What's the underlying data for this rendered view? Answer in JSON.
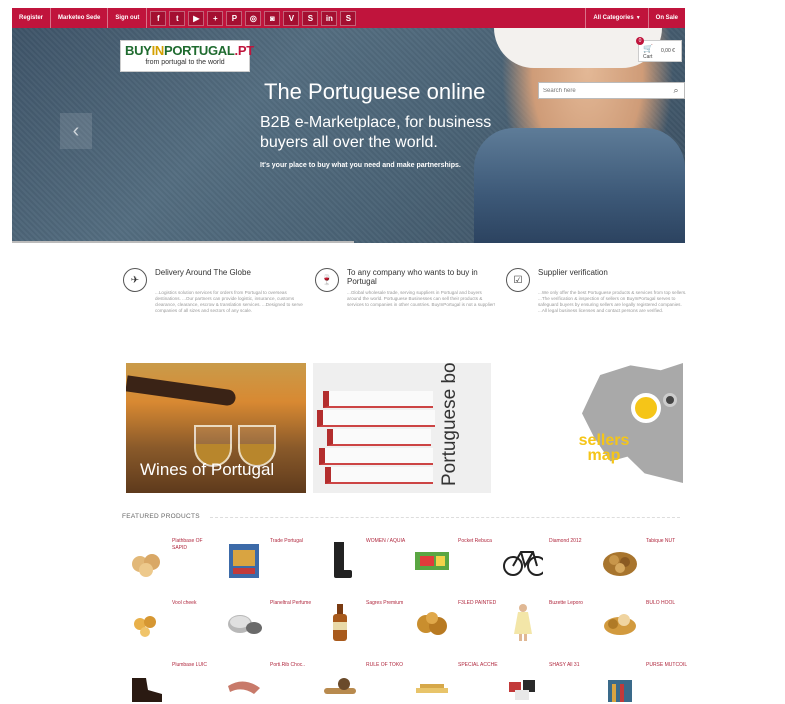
{
  "topbar": {
    "links": [
      "Register",
      "Marketeo Sede",
      "Sign out"
    ],
    "social_icons": [
      "facebook-icon",
      "twitter-icon",
      "youtube-icon",
      "share-icon",
      "pinterest-icon",
      "flickr-icon",
      "instagram-icon",
      "vimeo-icon",
      "tumblr-icon",
      "linkedin-icon",
      "skype-icon"
    ],
    "social_glyphs": [
      "f",
      "t",
      "▶",
      "+",
      "P",
      "◎",
      "◙",
      "V",
      "S",
      "in",
      "S"
    ],
    "categories_label": "All Categories",
    "sale_label": "On Sale",
    "accent_color": "#c0143c"
  },
  "hero": {
    "logo_main_a": "BUY",
    "logo_main_b": "IN",
    "logo_main_c": "PORTUGAL",
    "logo_main_d": ".PT",
    "logo_tagline": "from portugal to the world",
    "cart_count": "0",
    "cart_amount": "0,00 €",
    "cart_label": "Cart",
    "search_placeholder": "Search here",
    "headline": "The Portuguese online",
    "subheadline": "B2B e-Marketplace, for business buyers all over the world.",
    "tagline": "It's your place to buy what you need and make partnerships.",
    "prev_label": "‹",
    "next_label": "›"
  },
  "features": [
    {
      "icon": "airplane-icon",
      "glyph": "✈",
      "title": "Delivery Around The Globe",
      "text": "...Logistics solution services for orders from Portugal to overseas destinations. ...Our partners can provide logistic, insurance, customs clearance, clearance, escrow & translation services. ...Designed to serve companies of all sizes and sectors of any scale."
    },
    {
      "icon": "wine-glass-icon",
      "glyph": "🍷",
      "title": "To any company who wants to buy in Portugal",
      "text": "...Global wholesale trade, serving suppliers in Portugal and buyers around the world. Portuguese Businesses can sell their products & services to companies in other countries. BuyInPortugal is not a supplier!"
    },
    {
      "icon": "checkbox-icon",
      "glyph": "☑",
      "title": "Supplier verification",
      "text": "...We only offer the best Portuguese products & services from top sellers. ...The verification & inspection of sellers on BuyInPortugal serves to safeguard buyers by ensuring sellers are legally registered companies. ...All legal business licenses and contact persons are verified."
    }
  ],
  "banners": {
    "wine": "Wines of Portugal",
    "books": "Portuguese books",
    "map": "sellers map"
  },
  "featured": {
    "title": "FEATURED PRODUCTS",
    "products": [
      {
        "name": "Plathbase OF SAPID",
        "icon": "cookies-icon"
      },
      {
        "name": "Trade Portugal",
        "icon": "book-icon"
      },
      {
        "name": "WOMEN / AQUIA",
        "icon": "boots-icon"
      },
      {
        "name": "Pocket Rebuca",
        "icon": "candy-box-icon"
      },
      {
        "name": "Diamond 2012",
        "icon": "bicycle-icon"
      },
      {
        "name": "Tabique NUT",
        "icon": "nuts-icon"
      },
      {
        "name": "Vool cheek",
        "icon": "sweets-icon"
      },
      {
        "name": "Planeltral Perfume",
        "icon": "tin-icon"
      },
      {
        "name": "Sagres Premium",
        "icon": "beer-bottle-icon"
      },
      {
        "name": "F3LED PAINTED",
        "icon": "tart-icon"
      },
      {
        "name": "Buzette Leporo",
        "icon": "dress-icon"
      },
      {
        "name": "BULO HOOL",
        "icon": "pastry-icon"
      },
      {
        "name": "Plumbase LUIC",
        "icon": "shoe-icon"
      },
      {
        "name": "Porti.Rib Choc..",
        "icon": "shoe-horn-icon"
      },
      {
        "name": "RULE OF TOKO",
        "icon": "cork-icon"
      },
      {
        "name": "SPECIAL ACCHE",
        "icon": "pasta-icon"
      },
      {
        "name": "SHASY All 31",
        "icon": "sweets-mix-icon"
      },
      {
        "name": "PURSE MUTCOIL",
        "icon": "purse-icon"
      }
    ]
  }
}
